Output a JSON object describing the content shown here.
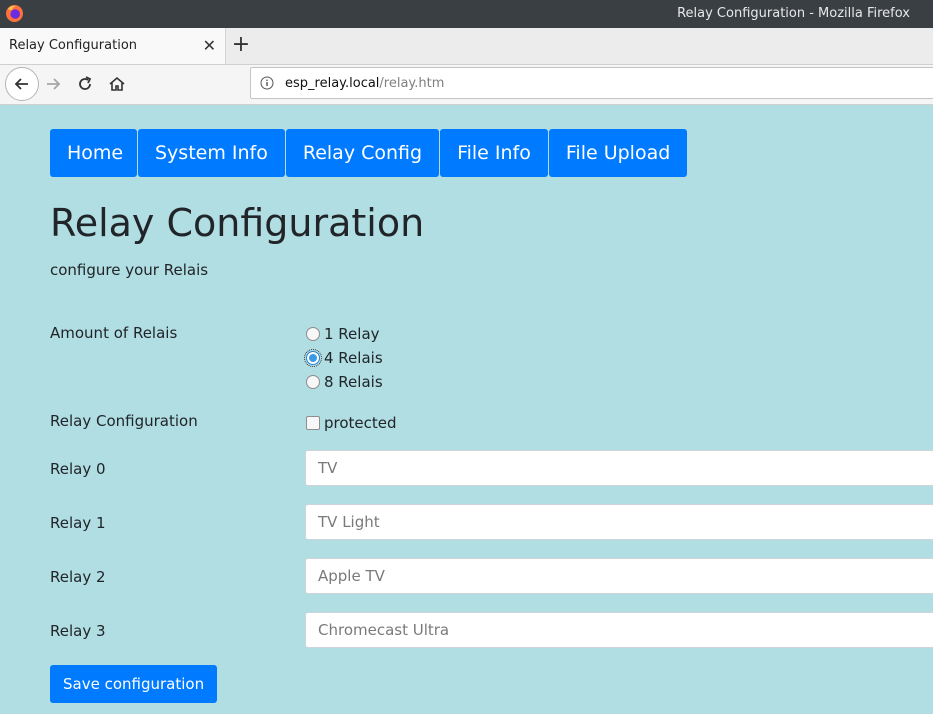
{
  "window": {
    "title": "Relay Configuration - Mozilla Firefox"
  },
  "tab": {
    "label": "Relay Configuration",
    "close": "✕",
    "new_tab": "+"
  },
  "address": {
    "host": "esp_relay.local",
    "path": "/relay.htm"
  },
  "menu": {
    "items": [
      "Home",
      "System Info",
      "Relay Config",
      "File Info",
      "File Upload"
    ]
  },
  "page": {
    "heading": "Relay Configuration",
    "subtitle": "configure your Relais"
  },
  "amount": {
    "label": "Amount of Relais",
    "options": [
      "1 Relay",
      "4 Relais",
      "8 Relais"
    ],
    "selected": "4 Relais"
  },
  "protection": {
    "label": "Relay Configuration",
    "checkbox_label": "protected",
    "checked": false
  },
  "relays": [
    {
      "label": "Relay 0",
      "value": "TV"
    },
    {
      "label": "Relay 1",
      "value": "TV Light"
    },
    {
      "label": "Relay 2",
      "value": "Apple TV"
    },
    {
      "label": "Relay 3",
      "value": "Chromecast Ultra"
    }
  ],
  "save_label": "Save configuration",
  "colors": {
    "accent": "#007bff",
    "page_bg": "#b0dee3"
  },
  "icons": [
    "firefox-logo-icon",
    "back-arrow-icon",
    "forward-arrow-icon",
    "reload-icon",
    "home-icon",
    "info-icon"
  ]
}
